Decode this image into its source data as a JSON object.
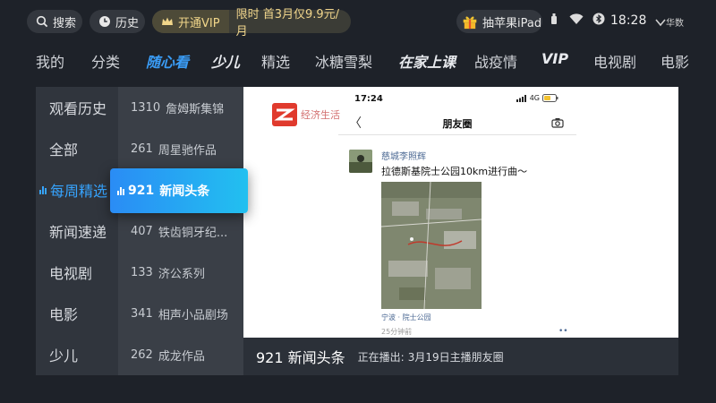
{
  "topbar": {
    "search_label": "搜索",
    "history_label": "历史",
    "vip_open_label": "开通VIP",
    "vip_promo": "限时 首3月仅9.9元/月",
    "ipad_promo": "抽苹果iPad",
    "time": "18:28",
    "brand": "华数"
  },
  "nav": {
    "items": [
      "我的",
      "分类",
      "随心看",
      "少儿",
      "精选",
      "冰糖雪梨",
      "在家上课",
      "战疫情",
      "VIP",
      "电视剧",
      "电影"
    ],
    "active_index": 2
  },
  "categories": {
    "items": [
      "观看历史",
      "全部",
      "每周精选",
      "新闻速递",
      "电视剧",
      "电影",
      "少儿"
    ],
    "selected_index": 2
  },
  "programs": {
    "items": [
      {
        "num": "1310",
        "title": "詹姆斯集锦"
      },
      {
        "num": "261",
        "title": "周星驰作品"
      },
      {
        "num": "921",
        "title": "新闻头条"
      },
      {
        "num": "407",
        "title": "铁齿铜牙纪..."
      },
      {
        "num": "133",
        "title": "济公系列"
      },
      {
        "num": "341",
        "title": "相声小品剧场"
      },
      {
        "num": "262",
        "title": "成龙作品"
      }
    ],
    "focused": {
      "num": "921",
      "title": "新闻头条"
    }
  },
  "video": {
    "channel_logo_text": "经济生活",
    "phone_time": "17:24",
    "phone_network": "4G",
    "screen_title": "朋友圈",
    "back_symbol": "〈",
    "post": {
      "author": "慈城李照辉",
      "text": "拉德斯基院士公园10km进行曲～",
      "location": "宁波 · 院士公园",
      "time": "25分钟前",
      "more": "••"
    }
  },
  "now_playing": {
    "channel": "921 新闻头条",
    "label": "正在播出:",
    "program": "3月19日主播朋友圈"
  },
  "colors": {
    "accent": "#3a9cf5",
    "focus_gradient_start": "#2a8cf5",
    "focus_gradient_end": "#22c0f0",
    "vip_gold": "#f1d68a",
    "background": "#1e2229"
  }
}
